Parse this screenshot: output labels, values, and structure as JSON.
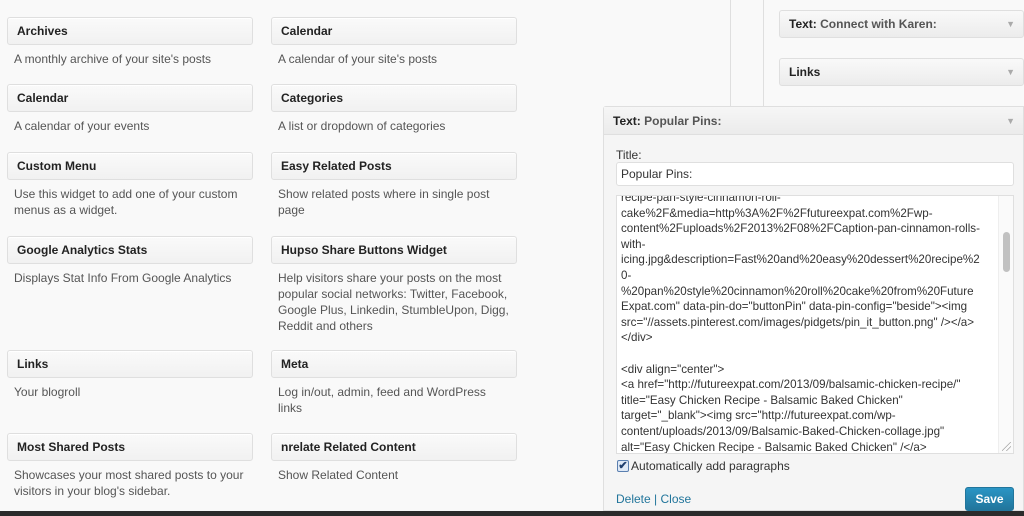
{
  "available_widgets": [
    {
      "title": "Archives",
      "description": "A monthly archive of your site's posts"
    },
    {
      "title": "Calendar",
      "description": "A calendar of your site's posts"
    },
    {
      "title": "Calendar",
      "description": "A calendar of your events"
    },
    {
      "title": "Categories",
      "description": "A list or dropdown of categories"
    },
    {
      "title": "Custom Menu",
      "description": "Use this widget to add one of your custom menus as a widget."
    },
    {
      "title": "Easy Related Posts",
      "description": "Show related posts where in single post page"
    },
    {
      "title": "Google Analytics Stats",
      "description": "Displays Stat Info From Google Analytics"
    },
    {
      "title": "Hupso Share Buttons Widget",
      "description": "Help visitors share your posts on the most popular social networks: Twitter, Facebook, Google Plus, Linkedin, StumbleUpon, Digg, Reddit and others"
    },
    {
      "title": "Links",
      "description": "Your blogroll"
    },
    {
      "title": "Meta",
      "description": "Log in/out, admin, feed and WordPress links"
    },
    {
      "title": "Most Shared Posts",
      "description": "Showcases your most shared posts to your visitors in your blog's sidebar."
    },
    {
      "title": "nrelate Related Content",
      "description": "Show Related Content"
    }
  ],
  "sidebar_widgets": [
    {
      "type": "Text:",
      "title": "Connect with Karen:"
    },
    {
      "type": "Links",
      "title": ""
    }
  ],
  "expanded_widget": {
    "type": "Text:",
    "title": "Popular Pins:",
    "title_label": "Title:",
    "title_value": "Popular Pins:",
    "content": "recipe-pan-style-cinnamon-roll-\ncake%2F&media=http%3A%2F%2Ffutureexpat.com%2Fwp-\ncontent%2Fuploads%2F2013%2F08%2FCaption-pan-cinnamon-rolls-\nwith-\nicing.jpg&description=Fast%20and%20easy%20dessert%20recipe%2\n0-\n%20pan%20style%20cinnamon%20roll%20cake%20from%20Future\nExpat.com\" data-pin-do=\"buttonPin\" data-pin-config=\"beside\"><img\nsrc=\"//assets.pinterest.com/images/pidgets/pin_it_button.png\" /></a>\n</div>\n\n<div align=\"center\">\n<a href=\"http://futureexpat.com/2013/09/balsamic-chicken-recipe/\"\ntitle=\"Easy Chicken Recipe - Balsamic Baked Chicken\"\ntarget=\"_blank\"><img src=\"http://futureexpat.com/wp-\ncontent/uploads/2013/09/Balsamic-Baked-Chicken-collage.jpg\"\nalt=\"Easy Chicken Recipe - Balsamic Baked Chicken\" /</a>",
    "auto_paragraphs_label": "Automatically add paragraphs",
    "auto_paragraphs_checked": true,
    "delete_label": "Delete",
    "separator": "|",
    "close_label": "Close",
    "save_label": "Save"
  },
  "icons": {
    "collapse_arrow": "▼",
    "checkmark": "✔"
  }
}
